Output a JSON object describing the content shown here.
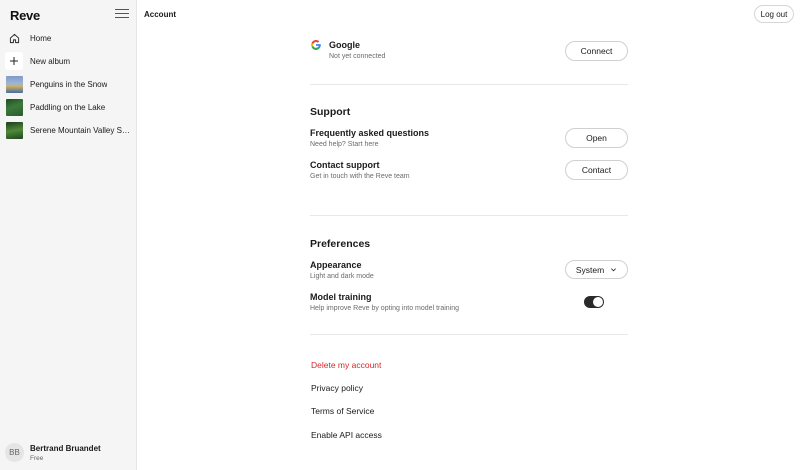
{
  "app": {
    "logo": "Reve"
  },
  "sidebar": {
    "items": [
      {
        "label": "Home",
        "icon": "home-icon"
      },
      {
        "label": "New album",
        "icon": "plus-icon"
      },
      {
        "label": "Penguins in the Snow",
        "icon": "album-thumbnail"
      },
      {
        "label": "Paddling on the Lake",
        "icon": "album-thumbnail"
      },
      {
        "label": "Serene Mountain Valley Sunrise",
        "icon": "album-thumbnail"
      }
    ],
    "user": {
      "initials": "BB",
      "name": "Bertrand Bruandet",
      "plan": "Free"
    }
  },
  "header": {
    "title": "Account",
    "logout_label": "Log out"
  },
  "accounts": {
    "google": {
      "title": "Google",
      "status": "Not yet connected",
      "button": "Connect"
    }
  },
  "support": {
    "title": "Support",
    "faq": {
      "title": "Frequently asked questions",
      "subtitle": "Need help? Start here",
      "button": "Open"
    },
    "contact": {
      "title": "Contact support",
      "subtitle": "Get in touch with the Reve team",
      "button": "Contact"
    }
  },
  "preferences": {
    "title": "Preferences",
    "appearance": {
      "title": "Appearance",
      "subtitle": "Light and dark mode",
      "value": "System"
    },
    "model_training": {
      "title": "Model training",
      "subtitle": "Help improve Reve by opting into model training",
      "enabled": true
    }
  },
  "links": {
    "delete_account": "Delete my account",
    "privacy_policy": "Privacy policy",
    "terms": "Terms of Service",
    "api_access": "Enable API access"
  },
  "colors": {
    "danger": "#d62828",
    "toggle_on": "#2a2a2a"
  }
}
